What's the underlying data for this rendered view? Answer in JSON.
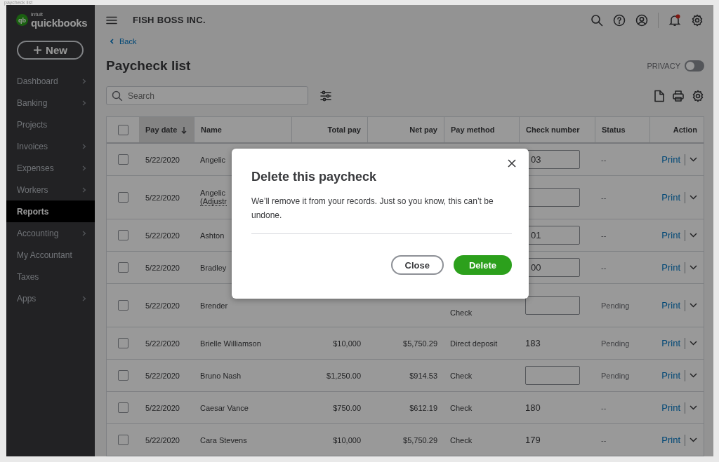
{
  "caption": "paycheck list",
  "logo": {
    "mark": "qb",
    "brand": "intuit",
    "name": "quickbooks"
  },
  "new_button": {
    "label": "New"
  },
  "sidebar": {
    "items": [
      {
        "label": "Dashboard",
        "submenu": true,
        "selected": false
      },
      {
        "label": "Banking",
        "submenu": true,
        "selected": false
      },
      {
        "label": "Projects",
        "submenu": false,
        "selected": false
      },
      {
        "label": "Invoices",
        "submenu": true,
        "selected": false
      },
      {
        "label": "Expenses",
        "submenu": true,
        "selected": false
      },
      {
        "label": "Workers",
        "submenu": true,
        "selected": false
      },
      {
        "label": "Reports",
        "submenu": false,
        "selected": true
      },
      {
        "label": "Accounting",
        "submenu": true,
        "selected": false
      },
      {
        "label": "My Accountant",
        "submenu": false,
        "selected": false
      },
      {
        "label": "Taxes",
        "submenu": false,
        "selected": false
      },
      {
        "label": "Apps",
        "submenu": true,
        "selected": false
      }
    ]
  },
  "topbar": {
    "company": "FISH BOSS INC."
  },
  "back_link": "Back",
  "title": "Paycheck list",
  "privacy": {
    "label": "PRIVACY",
    "on": false
  },
  "search": {
    "placeholder": "Search"
  },
  "table": {
    "header_checked": false,
    "columns": [
      {
        "label": "Pay date",
        "selected": true
      },
      {
        "label": "Name",
        "selected": false
      },
      {
        "label": "Total pay",
        "selected": false
      },
      {
        "label": "Net pay",
        "selected": false
      },
      {
        "label": "Pay method",
        "selected": false
      },
      {
        "label": "Check number",
        "selected": false
      },
      {
        "label": "Status",
        "selected": false
      },
      {
        "label": "Action",
        "selected": false
      }
    ],
    "rows": [
      {
        "checked": false,
        "date": "5/22/2020",
        "name": "Angelic",
        "check_number": {
          "kind": "field",
          "value": "03"
        },
        "status": "--",
        "action": "Print"
      },
      {
        "checked": false,
        "date": "5/22/2020",
        "name": "Angelic",
        "name_note": "(Adjustr",
        "check_number": {
          "kind": "field"
        },
        "status": "--",
        "action": "Print"
      },
      {
        "checked": false,
        "date": "5/22/2020",
        "name": "Ashton",
        "check_number": {
          "kind": "field",
          "value": "01"
        },
        "status": "--",
        "action": "Print"
      },
      {
        "checked": false,
        "date": "5/22/2020",
        "name": "Bradley",
        "check_number": {
          "kind": "field",
          "value": "00"
        },
        "status": "--",
        "action": "Print"
      },
      {
        "checked": false,
        "date": "5/22/2020",
        "name": "Brender",
        "pay_method": "Check",
        "check_number": {
          "kind": "field"
        },
        "status": "Pending",
        "action": "Print"
      },
      {
        "checked": false,
        "date": "5/22/2020",
        "name": "Brielle Williamson",
        "total_pay": "$10,000",
        "net_pay": "$5,750.29",
        "pay_method": "Direct deposit",
        "check_number": {
          "kind": "text",
          "value": "183"
        },
        "status": "Pending",
        "action": "Print"
      },
      {
        "checked": false,
        "date": "5/22/2020",
        "name": "Bruno Nash",
        "total_pay": "$1,250.00",
        "net_pay": "$914.53",
        "pay_method": "Check",
        "check_number": {
          "kind": "field"
        },
        "status": "Pending",
        "action": "Print"
      },
      {
        "checked": false,
        "date": "5/22/2020",
        "name": "Caesar Vance",
        "total_pay": "$750.00",
        "net_pay": "$612.19",
        "pay_method": "Check",
        "check_number": {
          "kind": "text",
          "value": "180"
        },
        "status": "--",
        "action": "Print"
      },
      {
        "checked": false,
        "date": "5/22/2020",
        "name": "Cara Stevens",
        "total_pay": "$10,000",
        "net_pay": "$5,750.29",
        "pay_method": "Check",
        "check_number": {
          "kind": "text",
          "value": "179"
        },
        "status": "--",
        "action": "Print"
      }
    ]
  },
  "dialog": {
    "title": "Delete this paycheck",
    "message": "We’ll remove it from your records. Just so you know, this can’t be undone.",
    "buttons": [
      {
        "label": "Close",
        "kind": "secondary"
      },
      {
        "label": "Delete",
        "kind": "primary"
      }
    ]
  }
}
